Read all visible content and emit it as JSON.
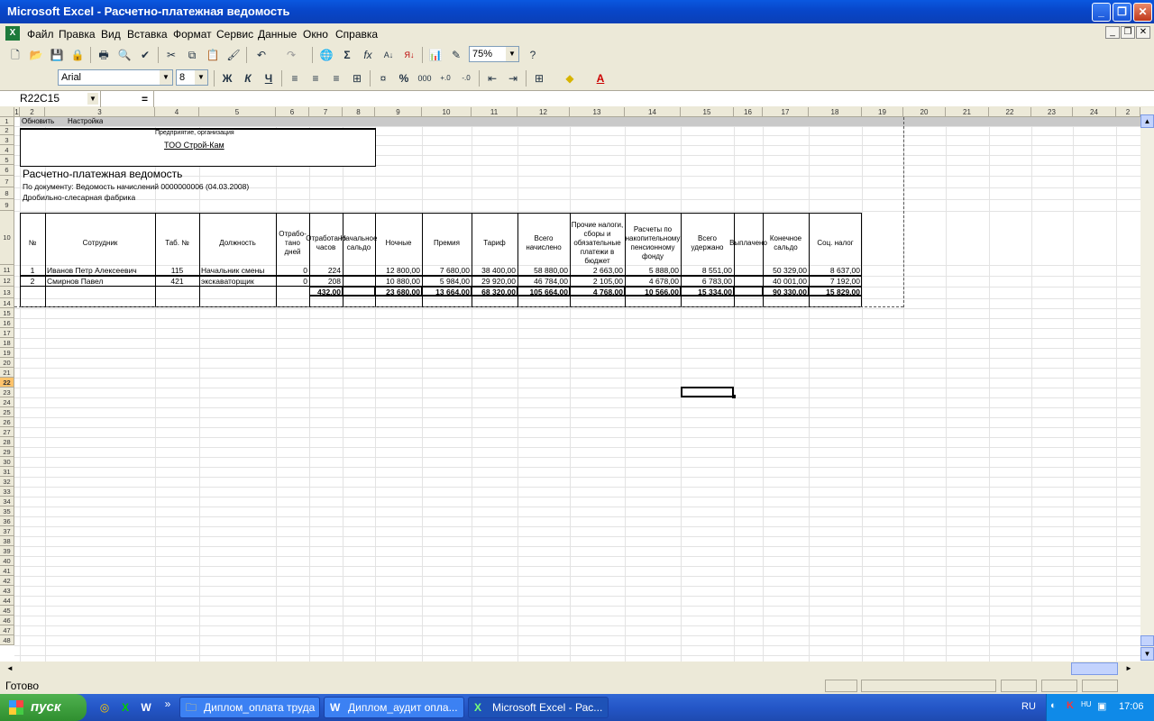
{
  "window": {
    "title": "Microsoft Excel - Расчетно-платежная ведомость"
  },
  "menu": [
    "Файл",
    "Правка",
    "Вид",
    "Вставка",
    "Формат",
    "Сервис",
    "Данные",
    "Окно",
    "Справка"
  ],
  "toolbar": {
    "zoom": "75%",
    "font": "Arial",
    "size": "8"
  },
  "formula": {
    "namebox": "R22C15",
    "eq": "="
  },
  "columns": [
    "1",
    "2",
    "3",
    "4",
    "5",
    "6",
    "7",
    "8",
    "9",
    "10",
    "11",
    "12",
    "13",
    "14",
    "15",
    "16",
    "17",
    "18",
    "19",
    "20",
    "21",
    "22",
    "23",
    "24",
    "2"
  ],
  "rows": [
    "1",
    "2",
    "3",
    "4",
    "5",
    "6",
    "7",
    "8",
    "9",
    "10",
    "11",
    "12",
    "13",
    "14",
    "15",
    "16",
    "17",
    "18",
    "19",
    "20",
    "21",
    "22",
    "23",
    "24",
    "25",
    "26",
    "27",
    "28",
    "29",
    "30",
    "31",
    "32",
    "33",
    "34",
    "35",
    "36",
    "37",
    "38",
    "39",
    "40",
    "41",
    "42",
    "43",
    "44",
    "45",
    "46",
    "47",
    "48"
  ],
  "sheet": {
    "btn_refresh": "Обновить",
    "btn_settings": "Настройка",
    "org_label": "Предприятие, организация",
    "org_name": "ТОО Строй-Кам",
    "title": "Расчетно-платежная ведомость",
    "doc": "По документу: Ведомость начислений 0000000006 (04.03.2008)",
    "dept": "Дробильно-слесарная фабрика",
    "headers": [
      "№",
      "Сотрудник",
      "Таб. №",
      "Должность",
      "Отрабо-тано дней",
      "Отработано часов",
      "Начальное сальдо",
      "Ночные",
      "Премия",
      "Тариф",
      "Всего начислено",
      "Прочие налоги, сборы и обязательные платежи в бюджет",
      "Расчеты по накопительному пенсионному фонду",
      "Всего удержано",
      "Выплачено",
      "Конечное сальдо",
      "Соц. налог"
    ],
    "rows": [
      [
        "1",
        "Иванов Петр Алексеевич",
        "115",
        "Начальник смены",
        "0",
        "224",
        "",
        "12 800,00",
        "7 680,00",
        "38 400,00",
        "58 880,00",
        "2 663,00",
        "5 888,00",
        "8 551,00",
        "",
        "50 329,00",
        "8 637,00"
      ],
      [
        "2",
        "Смирнов Павел",
        "421",
        "экскаваторщик",
        "0",
        "208",
        "",
        "10 880,00",
        "5 984,00",
        "29 920,00",
        "46 784,00",
        "2 105,00",
        "4 678,00",
        "6 783,00",
        "",
        "40 001,00",
        "7 192,00"
      ]
    ],
    "totals": [
      "",
      "",
      "",
      "",
      "",
      "432,00",
      "",
      "23 680,00",
      "13 664,00",
      "68 320,00",
      "105 664,00",
      "4 768,00",
      "10 566,00",
      "15 334,00",
      "",
      "90 330,00",
      "15 829,00"
    ]
  },
  "status": {
    "text": "Готово"
  },
  "taskbar": {
    "start": "пуск",
    "tasks": [
      "Диплом_оплата труда",
      "Диплом_аудит опла...",
      "Microsoft Excel - Рас..."
    ],
    "lang": "RU",
    "clock": "17:06"
  }
}
